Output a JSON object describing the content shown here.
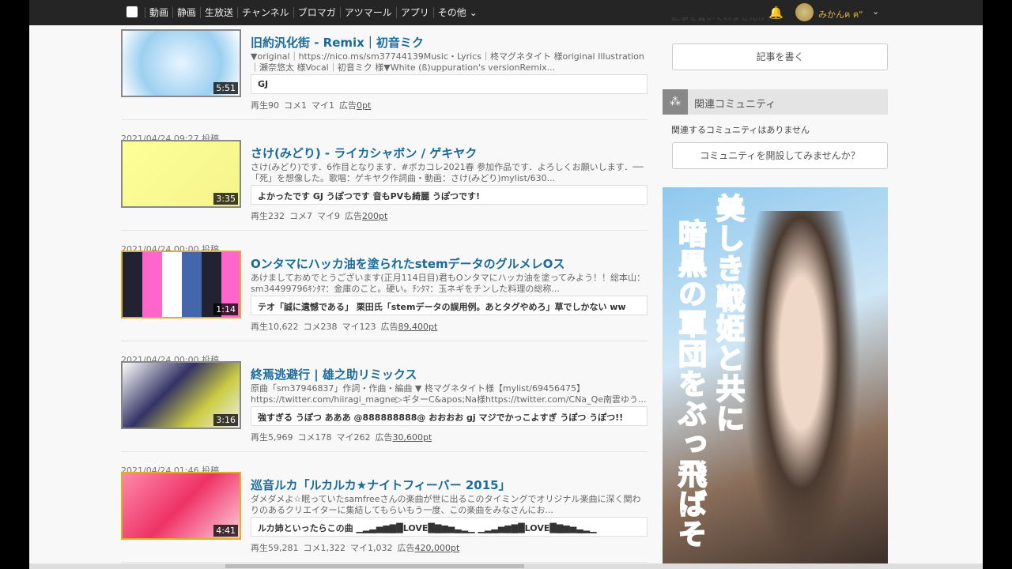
{
  "nav": {
    "items": [
      "動画",
      "静画",
      "生放送",
      "チャンネル",
      "ブロマガ",
      "アツマール",
      "アプリ",
      "その他"
    ],
    "username": "みかんฅ ฅ\"",
    "more_chevron": "chevron-down-icon"
  },
  "videos": [
    {
      "date": "",
      "title": "旧約汎化街 - Remix｜初音ミク",
      "desc": "▼original｜https://nico.ms/sm37744139Music・Lyrics｜柊マグネタイト 様original Illustration｜瀬奈悠太 様Vocal｜初音ミク 様▼White (ß)uppuration's versionRemix...",
      "comment": "GJ",
      "duration": "5:51",
      "views": "再生90",
      "comments": "コメ1",
      "mylist": "マイ1",
      "ad_label": "広告",
      "ad": "0pt"
    },
    {
      "date": "2021/04/24 09:27 投稿",
      "title": "さけ(みどり) - ライカシャボン / ゲキヤク",
      "desc": "さけ(みどり)です．6作目となります．#ボカコレ2021春 参加作品です．よろしくお願いします．──「死」を想像した。歌唱：ゲキヤク作詞曲・動画：さけ(みどり)mylist/630...",
      "comment": "よかったです GJ うぽつです 音もPVも綺麗 うぽつです!",
      "duration": "3:35",
      "views": "再生232",
      "comments": "コメ7",
      "mylist": "マイ9",
      "ad_label": "広告",
      "ad": "200pt"
    },
    {
      "date": "2021/04/24 00:00 投稿",
      "title": "Oンタマにハッカ油を塗られたstemデータのグルメレOス",
      "desc": "あけましておめでとうございます(正月114日目)君もOンタマにハッカ油を塗ってみよう！！総本山：sm34499796ｷﾝﾀﾏ：金庫のこと。硬い。ﾁﾝﾀﾏ：玉ネギをチンした料理の総称...",
      "comment": "テオ「誠に遺憾である」 栗田氏「stemデータの誤用例。あとタグやめろ」草でしかない ww",
      "duration": "1:14",
      "views": "再生10,622",
      "comments": "コメ238",
      "mylist": "マイ123",
      "ad_label": "広告",
      "ad": "89,400pt"
    },
    {
      "date": "2021/04/24 00:00 投稿",
      "title": "終焉逃避行 | 雄之助リミックス",
      "desc": "原曲「sm37946837」作詞・作曲・編曲 ▼ 柊マグネタイト様【mylist/69456475】https://twitter.com/hiiragi_magne▷ギターC&apos;Na様https://twitter.com/CNa_Qe南雲ゆう...",
      "comment": "強すぎる うぽつ あああ @888888888@ おおおお gj マジでかっこよすぎ うぽつ うぽつ!!",
      "duration": "3:16",
      "views": "再生5,969",
      "comments": "コメ178",
      "mylist": "マイ262",
      "ad_label": "広告",
      "ad": "30,600pt"
    },
    {
      "date": "2021/04/24 01:46 投稿",
      "title": "巡音ルカ「ルカルカ★ナイトフィーバー 2015」",
      "desc": "ダメダメよ☆眠っていたsamfreeさんの楽曲が世に出るこのタイミングでオリジナル楽曲に深く関わりのあるクリエイターに集結してもらいもう一度、この楽曲をみなさんにお...",
      "comment": "ルカ姉といったらこの曲 ▁▂▃▅▆▇█LOVE█▇▆▅▃▂▁ ▁▂▃▅▆▇█LOVE█▇▆▅▃▂▁",
      "duration": "4:41",
      "views": "再生59,281",
      "comments": "コメ1,322",
      "mylist": "マイ1,032",
      "ad_label": "広告",
      "ad": "420,000pt"
    }
  ],
  "sidebar": {
    "cut_text": "記事を書いてみませんか？",
    "write_article": "記事を書く",
    "community_title": "関連コミュニティ",
    "community_none": "関連するコミュニティはありません",
    "create_community": "コミュニティを開設してみませんか？"
  },
  "ad": {
    "line1": "美しき戦姫と共に",
    "line2": "暗黒の軍団をぶっ飛ばそ"
  }
}
